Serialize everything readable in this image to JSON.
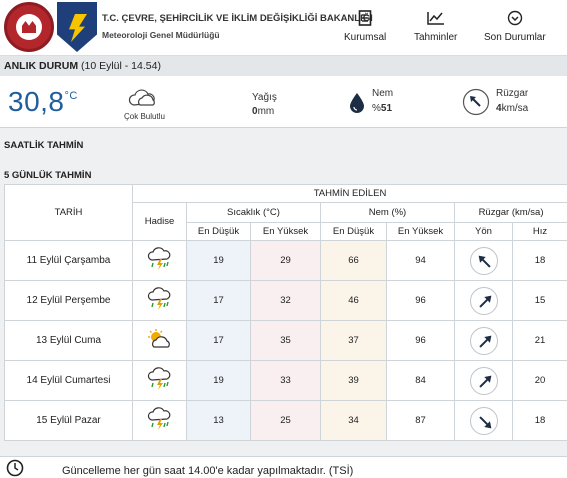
{
  "header": {
    "org_line1": "T.C. ÇEVRE, ŞEHİRCİLİK VE İKLİM DEĞİŞİKLİĞİ BAKANLIĞI",
    "org_line2": "Meteoroloji Genel Müdürlüğü",
    "nav": [
      {
        "label": "Kurumsal",
        "icon": "document-icon"
      },
      {
        "label": "Tahminler",
        "icon": "chart-icon"
      },
      {
        "label": "Son Durumlar",
        "icon": "chevron-circle-icon"
      }
    ]
  },
  "current": {
    "title": "ANLIK DURUM",
    "timestamp": "(10 Eylül - 14.54)",
    "temperature": "30,8",
    "temp_unit": "°C",
    "condition": "Çok Bulutlu",
    "rain_label": "Yağış",
    "rain_value": "0",
    "rain_unit": "mm",
    "humidity_label": "Nem",
    "humidity_prefix": "%",
    "humidity_value": "51",
    "wind_label": "Rüzgar",
    "wind_value": "4",
    "wind_unit": "km/sa"
  },
  "sections": {
    "hourly": "SAATLİK TAHMİN",
    "five_day": "5 GÜNLÜK TAHMİN"
  },
  "table": {
    "header_estimated": "TAHMİN EDİLEN",
    "col_date": "TARİH",
    "col_event": "Hadise",
    "col_temp": "Sıcaklık (°C)",
    "col_hum": "Nem (%)",
    "col_wind": "Rüzgar (km/sa)",
    "sub_min": "En Düşük",
    "sub_max": "En Yüksek",
    "sub_dir": "Yön",
    "sub_speed": "Hız",
    "rows": [
      {
        "date": "11 Eylül Çarşamba",
        "icon": "thunderstorm-icon",
        "tmin": "19",
        "tmax": "29",
        "hmin": "66",
        "hmax": "94",
        "wind_dir": "north-west",
        "wind_speed": "18"
      },
      {
        "date": "12 Eylül Perşembe",
        "icon": "thunderstorm-icon",
        "tmin": "17",
        "tmax": "32",
        "hmin": "46",
        "hmax": "96",
        "wind_dir": "north-east",
        "wind_speed": "15"
      },
      {
        "date": "13 Eylül Cuma",
        "icon": "partly-cloudy-sun-icon",
        "tmin": "17",
        "tmax": "35",
        "hmin": "37",
        "hmax": "96",
        "wind_dir": "north-east",
        "wind_speed": "21"
      },
      {
        "date": "14 Eylül Cumartesi",
        "icon": "thunderstorm-icon",
        "tmin": "19",
        "tmax": "33",
        "hmin": "39",
        "hmax": "84",
        "wind_dir": "north-east",
        "wind_speed": "20"
      },
      {
        "date": "15 Eylül Pazar",
        "icon": "thunderstorm-icon",
        "tmin": "13",
        "tmax": "25",
        "hmin": "34",
        "hmax": "87",
        "wind_dir": "south-east",
        "wind_speed": "18"
      }
    ]
  },
  "footer": {
    "text": "Güncelleme her gün saat 14.00'e kadar yapılmaktadır. (TSİ)"
  },
  "colors": {
    "temp_blue": "#1e5e9e",
    "min_blue": "#2a68b0",
    "max_red": "#c4262c",
    "min_orange": "#c57a00"
  }
}
